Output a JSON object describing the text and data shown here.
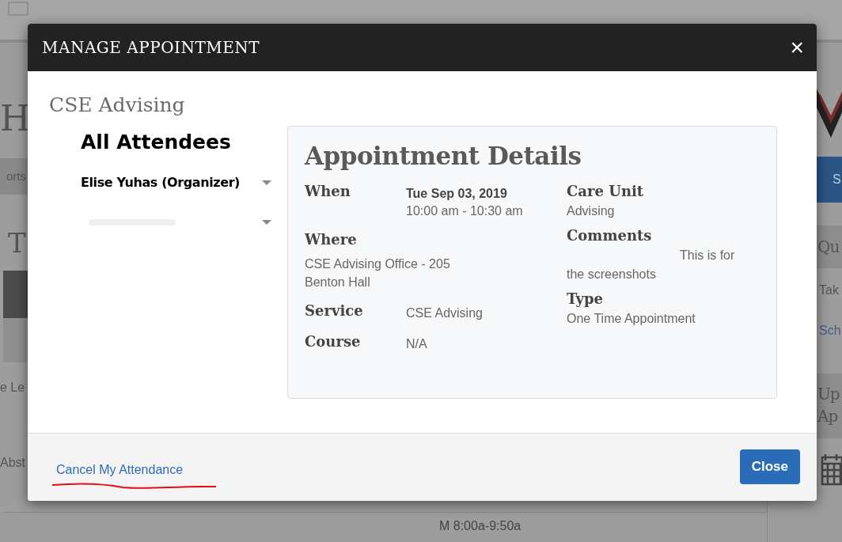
{
  "background": {
    "heading": "H",
    "tab": "orts",
    "section": "T",
    "rows": [
      "e Le",
      "Abst"
    ],
    "schedule": "M 8:00a-9:50a",
    "sidebar": {
      "button": "S",
      "heading": "Qu",
      "line": "Tak",
      "link": "Sch",
      "heading_2": [
        "Up",
        "Ap"
      ]
    }
  },
  "modal": {
    "title": "MANAGE APPOINTMENT",
    "close_icon": "×",
    "unit": "CSE Advising",
    "attendees": {
      "heading": "All Attendees",
      "items": [
        {
          "name": "Elise Yuhas (Organizer)",
          "redacted": false
        },
        {
          "redacted": true
        }
      ]
    },
    "details": {
      "title": "Appointment Details",
      "left": [
        {
          "label": "When",
          "value_bold": "Tue Sep 03, 2019",
          "value": "10:00 am - 10:30 am",
          "kind": "inline"
        },
        {
          "label": "Where",
          "value": "CSE Advising Office - 205 Benton Hall",
          "kind": "stacked"
        },
        {
          "label": "Service",
          "value": "CSE Advising",
          "kind": "inline"
        },
        {
          "label": "Course",
          "value": "N/A",
          "kind": "inline"
        }
      ],
      "right": [
        {
          "label": "Care Unit",
          "value": "Advising",
          "redacted": false
        },
        {
          "label": "Comments",
          "value": "This is for the screenshots",
          "redacted": true
        },
        {
          "label": "Type",
          "value": "One Time Appointment",
          "redacted": false
        }
      ]
    },
    "footer": {
      "link": "Cancel My Attendance",
      "link_underlined": true,
      "button": "Close"
    }
  }
}
